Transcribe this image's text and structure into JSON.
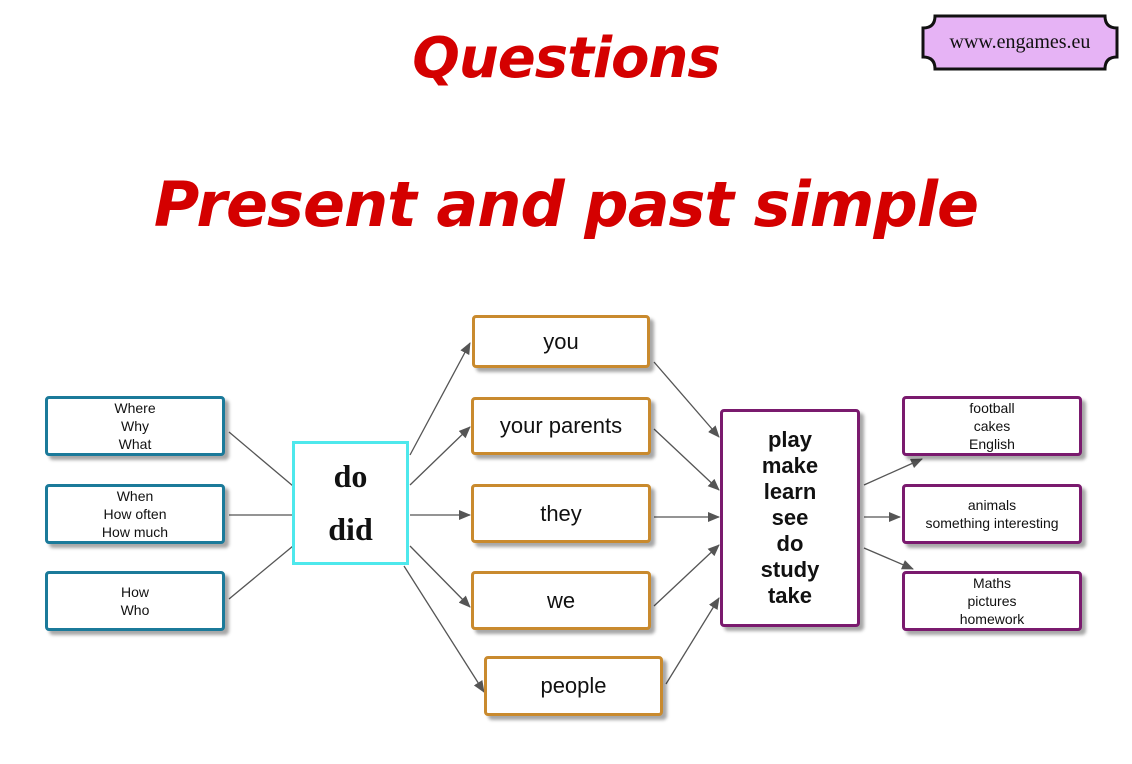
{
  "titles": {
    "main": "Questions",
    "sub": "Present and past simple"
  },
  "badge": {
    "text": "www.engames.eu",
    "fill": "#e6b3f5"
  },
  "question_words": [
    {
      "lines": [
        "Where",
        "Why",
        "What"
      ]
    },
    {
      "lines": [
        "When",
        "How often",
        "How much"
      ]
    },
    {
      "lines": [
        "How",
        "Who"
      ]
    }
  ],
  "auxiliary": {
    "lines": [
      "do",
      "did"
    ]
  },
  "subjects": [
    "you",
    "your parents",
    "they",
    "we",
    "people"
  ],
  "verbs": {
    "lines": [
      "play",
      "make",
      "learn",
      "see",
      "do",
      "study",
      "take"
    ]
  },
  "objects": [
    {
      "lines": [
        "football",
        "cakes",
        "English"
      ]
    },
    {
      "lines": [
        "animals",
        "something interesting"
      ]
    },
    {
      "lines": [
        "Maths",
        "pictures",
        "homework"
      ]
    }
  ],
  "colors": {
    "title": "#d40000",
    "question_border": "#1b7a9a",
    "aux_border": "#4ee8ec",
    "subject_border": "#c98a2e",
    "verb_border": "#7a1a6e",
    "edge": "#555555"
  }
}
